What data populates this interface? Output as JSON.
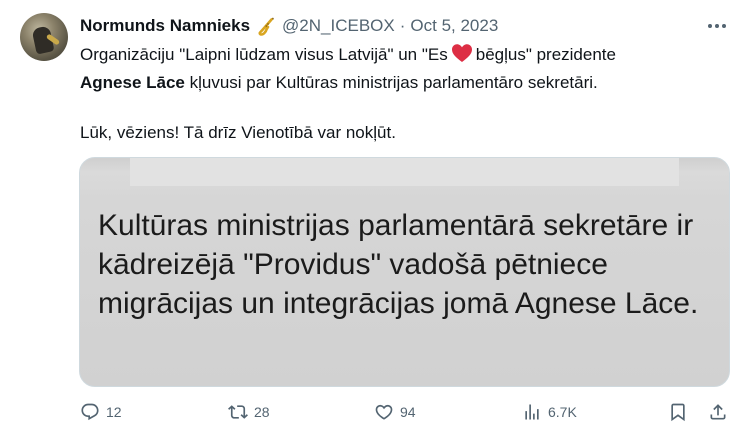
{
  "author": {
    "name": "Normunds Namnieks",
    "handle": "@2N_ICEBOX",
    "separator": "·",
    "date": "Oct 5, 2023"
  },
  "tweet": {
    "line1_before_heart": "Organizāciju \"Laipni lūdzam visus Latvijā\" un \"Es",
    "line1_after_heart": "bēgļus\"  prezidente",
    "bold_name": "Agnese Lāce",
    "line2_rest": " kļuvusi par Kultūras ministrijas parlamentāro sekretāri.",
    "line3": "Lūk, vēziens! Tā drīz Vienotībā var nokļūt."
  },
  "media": {
    "text": "Kultūras ministrijas parlamentārā sekretāre ir kādreizējā \"Providus\" vadošā pētniece migrācijas un integrācijas jomā Agnese Lāce."
  },
  "actions": {
    "reply_count": "12",
    "retweet_count": "28",
    "like_count": "94",
    "views_count": "6.7K"
  },
  "icons": {
    "verified_emoji": "saxophone-icon",
    "heart_emoji": "red-heart-icon",
    "heart_color": "#e0245e",
    "muted_text_color": "#536471"
  }
}
